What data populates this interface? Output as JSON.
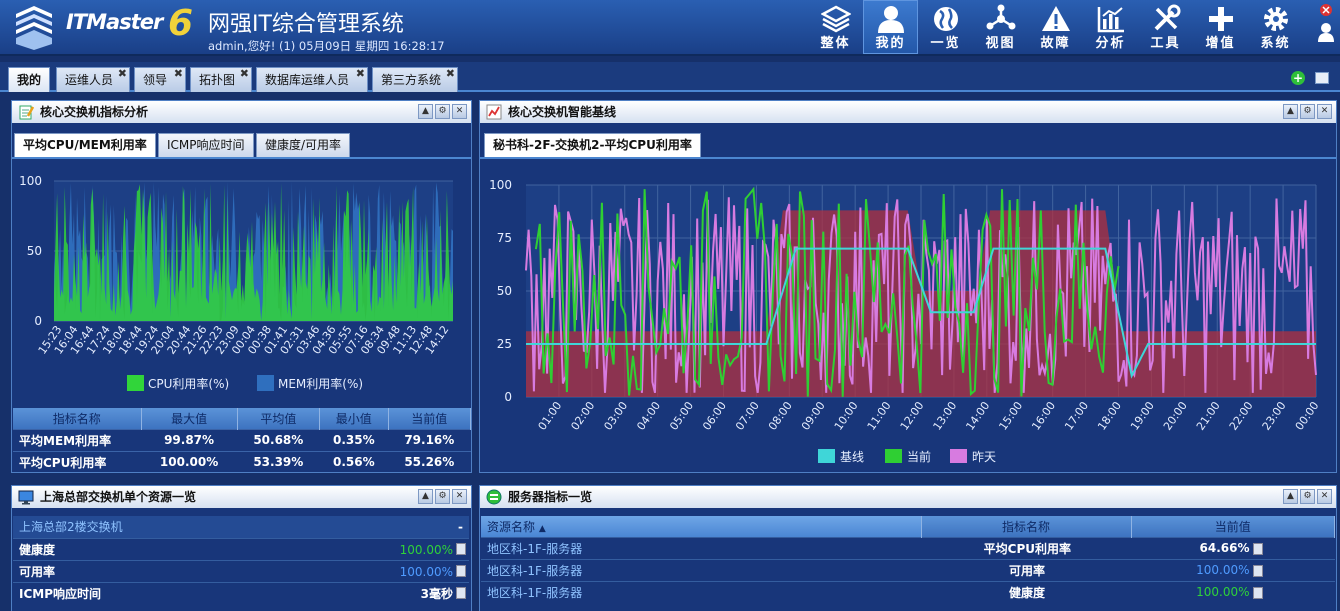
{
  "header": {
    "logo_text": "ITMaster",
    "logo_version": "6",
    "title": "网强IT综合管理系统",
    "subtitle": "admin,您好! (1) 05月09日 星期四 16:28:17"
  },
  "nav": [
    {
      "label": "整体",
      "icon": "layers-icon"
    },
    {
      "label": "我的",
      "icon": "user-icon",
      "active": true
    },
    {
      "label": "一览",
      "icon": "globe-icon"
    },
    {
      "label": "视图",
      "icon": "topology-icon"
    },
    {
      "label": "故障",
      "icon": "warning-icon"
    },
    {
      "label": "分析",
      "icon": "bar-chart-icon"
    },
    {
      "label": "工具",
      "icon": "tools-icon"
    },
    {
      "label": "增值",
      "icon": "plus-icon"
    },
    {
      "label": "系统",
      "icon": "gear-icon"
    }
  ],
  "tabs": [
    "我的",
    "运维人员",
    "领导",
    "拓扑图",
    "数据库运维人员",
    "第三方系统"
  ],
  "panel1": {
    "title": "核心交换机指标分析",
    "tabs": [
      "平均CPU/MEM利用率",
      "ICMP响应时间",
      "健康度/可用率"
    ],
    "chart": {
      "y_ticks": [
        "100",
        "50",
        "0"
      ],
      "x_ticks": [
        "15:23",
        "16:04",
        "16:44",
        "17:24",
        "18:04",
        "18:44",
        "19:24",
        "20:04",
        "20:44",
        "21:26",
        "22:23",
        "23:09",
        "00:04",
        "00:38",
        "01:41",
        "02:31",
        "03:46",
        "04:36",
        "05:55",
        "07:16",
        "08:34",
        "09:48",
        "11:13",
        "12:48",
        "14:12"
      ],
      "legend": [
        "CPU利用率(%)",
        "MEM利用率(%)"
      ],
      "colors": {
        "cpu": "#31d53a",
        "mem": "#2f6fbe"
      }
    },
    "table": {
      "headers": [
        "指标名称",
        "最大值",
        "平均值",
        "最小值",
        "当前值"
      ],
      "rows": [
        [
          "平均MEM利用率",
          "99.87%",
          "50.68%",
          "0.35%",
          "79.16%"
        ],
        [
          "平均CPU利用率",
          "100.00%",
          "53.39%",
          "0.56%",
          "55.26%"
        ]
      ]
    }
  },
  "panel2": {
    "title": "核心交换机智能基线",
    "tab": "秘书科-2F-交换机2-平均CPU利用率",
    "chart": {
      "y_ticks": [
        "100",
        "75",
        "50",
        "25",
        "0"
      ],
      "x_ticks": [
        "01:00",
        "02:00",
        "03:00",
        "04:00",
        "05:00",
        "06:00",
        "07:00",
        "08:00",
        "09:00",
        "10:00",
        "11:00",
        "12:00",
        "13:00",
        "14:00",
        "15:00",
        "16:00",
        "17:00",
        "18:00",
        "19:00",
        "20:00",
        "21:00",
        "22:00",
        "23:00",
        "00:00"
      ],
      "legend": [
        "基线",
        "当前",
        "昨天"
      ],
      "colors": {
        "baseline": "#3fd6d8",
        "current": "#2fcf33",
        "yesterday": "#d77be0",
        "band": "#b2303f"
      }
    }
  },
  "panel3": {
    "title": "上海总部交换机单个资源一览",
    "device": "上海总部2楼交换机",
    "collapse": "-",
    "rows": [
      {
        "k": "健康度",
        "v": "100.00%",
        "c": "#2fd13a"
      },
      {
        "k": "可用率",
        "v": "100.00%",
        "c": "#4f9bff"
      },
      {
        "k": "ICMP响应时间",
        "v": "3毫秒",
        "c": "#ffffff"
      }
    ]
  },
  "panel4": {
    "title": "服务器指标一览",
    "headers": [
      "资源名称",
      "指标名称",
      "当前值"
    ],
    "rows": [
      {
        "r": "地区科-1F-服务器",
        "m": "平均CPU利用率",
        "v": "64.66%",
        "c": "#ffffff"
      },
      {
        "r": "地区科-1F-服务器",
        "m": "可用率",
        "v": "100.00%",
        "c": "#4f9bff"
      },
      {
        "r": "地区科-1F-服务器",
        "m": "健康度",
        "v": "100.00%",
        "c": "#2fd13a"
      }
    ]
  }
}
